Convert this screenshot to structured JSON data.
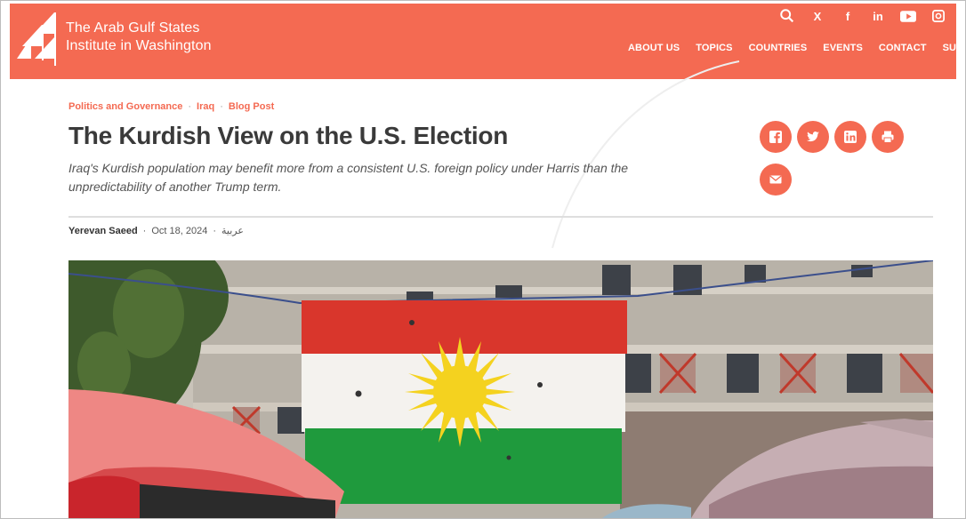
{
  "site": {
    "name_line1": "The Arab Gulf States",
    "name_line2": "Institute in Washington"
  },
  "colors": {
    "brand": "#f46a52",
    "title_text": "#3a3a3a",
    "flag_red": "#d9362c",
    "flag_white": "#ffffff",
    "flag_green": "#1f9a3d",
    "sun_yellow": "#f4d21f"
  },
  "header": {
    "social_icons": [
      "search-icon",
      "x-icon",
      "facebook-icon",
      "linkedin-icon",
      "youtube-icon",
      "instagram-icon"
    ],
    "social_glyphs": {
      "x": "X",
      "facebook": "f",
      "linkedin": "in"
    },
    "nav": [
      {
        "label": "ABOUT US"
      },
      {
        "label": "TOPICS"
      },
      {
        "label": "COUNTRIES"
      },
      {
        "label": "EVENTS"
      },
      {
        "label": "CONTACT"
      },
      {
        "label": "SUPP"
      }
    ]
  },
  "article": {
    "breadcrumbs": [
      "Politics and Governance",
      "Iraq",
      "Blog Post"
    ],
    "breadcrumb_sep": "·",
    "title": "The Kurdish View on the U.S. Election",
    "subtitle": "Iraq's Kurdish population may benefit more from a consistent U.S. foreign policy under Harris than the unpredictability of another Trump term.",
    "author": "Yerevan Saeed",
    "date": "Oct 18, 2024",
    "language_link": "عربية",
    "byline_sep": "·"
  },
  "share": {
    "icons": [
      "facebook-share-icon",
      "twitter-share-icon",
      "linkedin-share-icon",
      "print-icon",
      "email-icon"
    ]
  }
}
